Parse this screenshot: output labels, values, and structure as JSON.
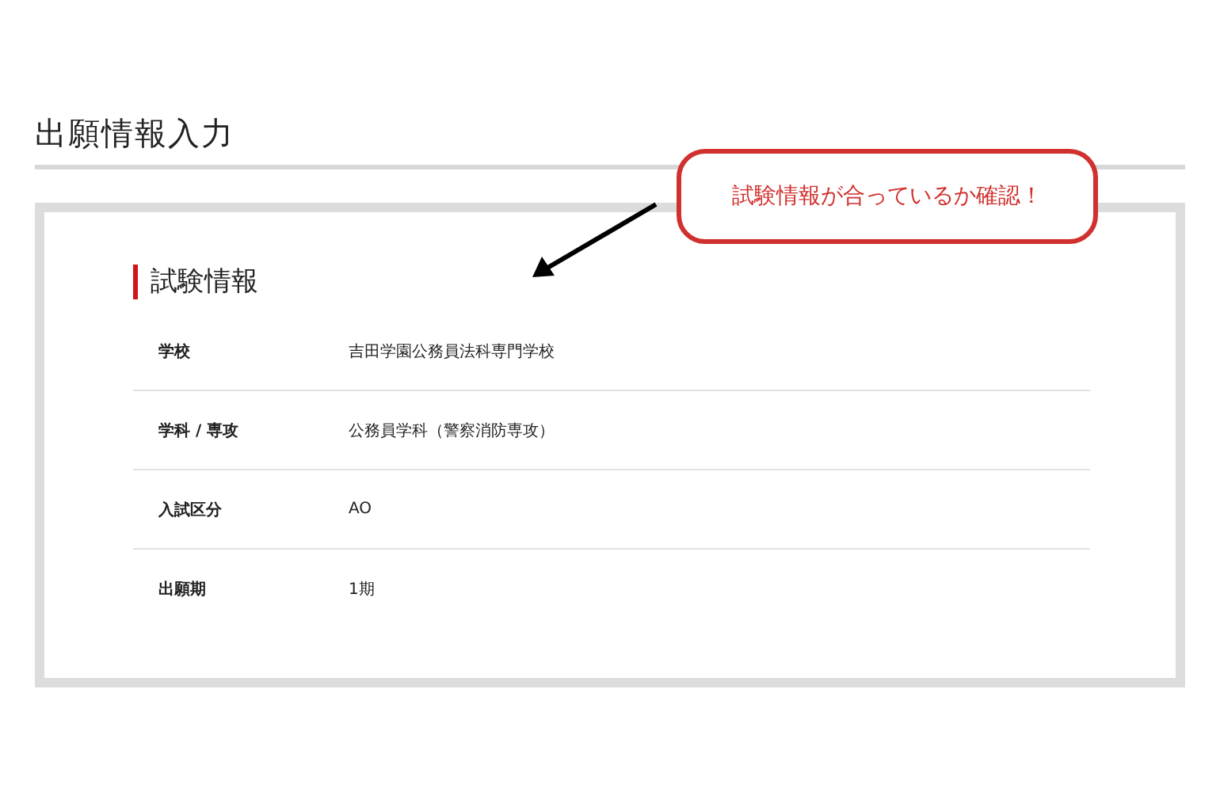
{
  "page_title": "出願情報入力",
  "callout": {
    "text": "試験情報が合っているか確認！"
  },
  "section": {
    "title": "試験情報",
    "rows": [
      {
        "label": "学校",
        "value": "吉田学園公務員法科専門学校"
      },
      {
        "label": "学科 / 専攻",
        "value": "公務員学科（警察消防専攻）"
      },
      {
        "label": "入試区分",
        "value": "AO"
      },
      {
        "label": "出願期",
        "value": "1期"
      }
    ]
  }
}
